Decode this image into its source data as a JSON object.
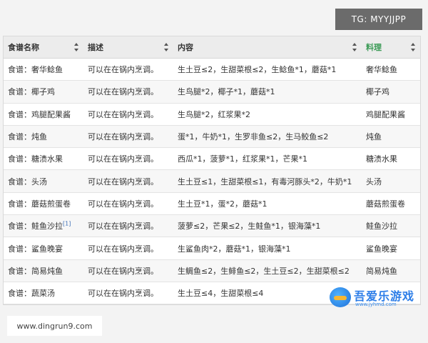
{
  "badge": "TG: MYYJJPP",
  "table": {
    "headers": [
      "食谱名称",
      "描述",
      "内容",
      "料理"
    ],
    "rows": [
      [
        "食谱：奢华鲶鱼",
        "可以在在锅内烹调。",
        "生土豆≤2，生甜菜根≤2，生鲶鱼*1，蘑菇*1",
        "奢华鲶鱼"
      ],
      [
        "食谱：椰子鸡",
        "可以在在锅内烹调。",
        "生鸟腿*2，椰子*1，蘑菇*1",
        "椰子鸡"
      ],
      [
        "食谱：鸡腿配果酱",
        "可以在在锅内烹调。",
        "生鸟腿*2，红浆果*2",
        "鸡腿配果酱"
      ],
      [
        "食谱：炖鱼",
        "可以在在锅内烹调。",
        "蛋*1，牛奶*1，生罗非鱼≤2，生马鲛鱼≤2",
        "炖鱼"
      ],
      [
        "食谱：糖渍水果",
        "可以在在锅内烹调。",
        "西瓜*1，菠萝*1，红浆果*1，芒果*1",
        "糖渍水果"
      ],
      [
        "食谱：头汤",
        "可以在在锅内烹调。",
        "生土豆≤1，生甜菜根≤1，有毒河豚头*2，牛奶*1",
        "头汤"
      ],
      [
        "食谱：蘑菇煎蛋卷",
        "可以在在锅内烹调。",
        "生土豆*1，蛋*2，蘑菇*1",
        "蘑菇煎蛋卷"
      ],
      [
        "食谱：鲑鱼沙拉",
        "可以在在锅内烹调。",
        "菠萝≤2，芒果≤2，生鲑鱼*1，银海藻*1",
        "鲑鱼沙拉"
      ],
      [
        "食谱：鲨鱼晚宴",
        "可以在在锅内烹调。",
        "生鲨鱼肉*2，蘑菇*1，银海藻*1",
        "鲨鱼晚宴"
      ],
      [
        "食谱：简易炖鱼",
        "可以在在锅内烹调。",
        "生鲷鱼≤2，生鲱鱼≤2，生土豆≤2，生甜菜根≤2",
        "简易炖鱼"
      ],
      [
        "食谱：蔬菜汤",
        "可以在在锅内烹调。",
        "生土豆≤4，生甜菜根≤4",
        ""
      ]
    ],
    "salmon_ref": "[1]"
  },
  "footer_url": "www.dingrun9.com",
  "watermark": {
    "text": "吾爱乐游戏",
    "sub": "www.jyhmd.com"
  },
  "colors": {
    "sorted_header": "#3a9a55",
    "badge_bg": "#6b6b6b"
  }
}
